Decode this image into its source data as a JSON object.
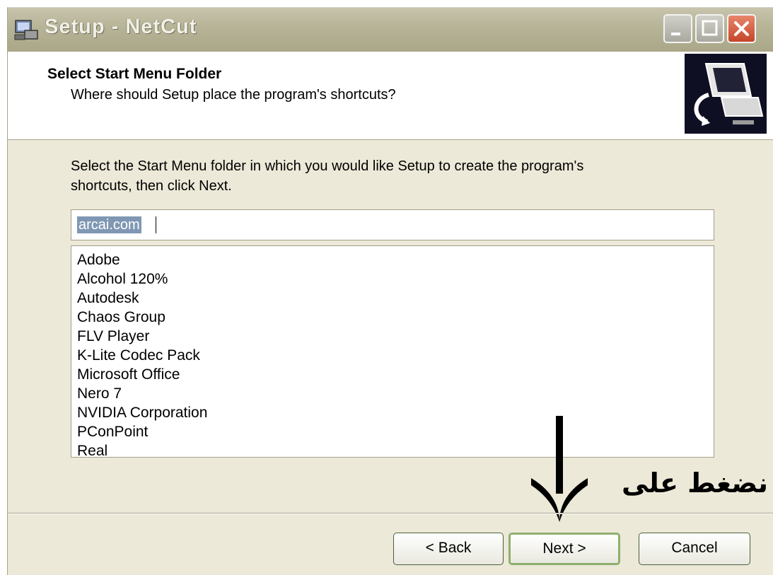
{
  "window": {
    "title": "Setup - NetCut"
  },
  "header": {
    "title": "Select Start Menu Folder",
    "subtitle": "Where should Setup place the program's shortcuts?"
  },
  "instructions": {
    "line1": "Select the Start Menu folder in which you would like Setup to create the program's",
    "line2": "shortcuts, then click Next."
  },
  "folder_input": {
    "value": "arcai.com"
  },
  "folder_list": {
    "items": [
      "Adobe",
      "Alcohol 120%",
      "Autodesk",
      "Chaos Group",
      "FLV Player",
      "K-Lite Codec Pack",
      "Microsoft Office",
      "Nero 7",
      "NVIDIA Corporation",
      "PConPoint",
      "Real"
    ]
  },
  "annotation": {
    "text": "نضغط على"
  },
  "buttons": {
    "back": "< Back",
    "next": "Next >",
    "cancel": "Cancel"
  },
  "icons": {
    "app": "setup-computer-icon",
    "minimize": "minimize-icon",
    "maximize": "maximize-icon",
    "close": "close-icon",
    "header": "install-computer-icon",
    "scroll_up": "chevron-up-icon",
    "scroll_down": "chevron-down-icon",
    "annotation": "arrow-down-icon"
  },
  "colors": {
    "close_button": "#c6462a",
    "selection": "#7f97b3",
    "header_icon_bg": "#0f0f24"
  }
}
